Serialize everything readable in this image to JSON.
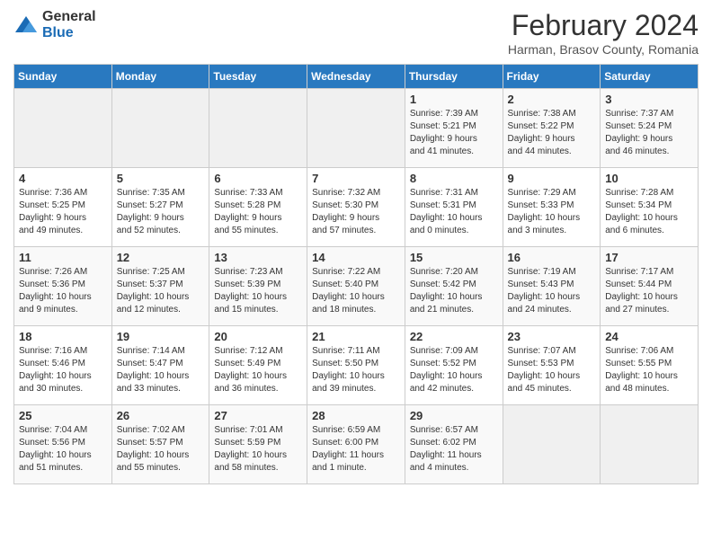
{
  "logo": {
    "general": "General",
    "blue": "Blue"
  },
  "header": {
    "title": "February 2024",
    "subtitle": "Harman, Brasov County, Romania"
  },
  "days_of_week": [
    "Sunday",
    "Monday",
    "Tuesday",
    "Wednesday",
    "Thursday",
    "Friday",
    "Saturday"
  ],
  "weeks": [
    [
      {
        "day": "",
        "info": ""
      },
      {
        "day": "",
        "info": ""
      },
      {
        "day": "",
        "info": ""
      },
      {
        "day": "",
        "info": ""
      },
      {
        "day": "1",
        "info": "Sunrise: 7:39 AM\nSunset: 5:21 PM\nDaylight: 9 hours\nand 41 minutes."
      },
      {
        "day": "2",
        "info": "Sunrise: 7:38 AM\nSunset: 5:22 PM\nDaylight: 9 hours\nand 44 minutes."
      },
      {
        "day": "3",
        "info": "Sunrise: 7:37 AM\nSunset: 5:24 PM\nDaylight: 9 hours\nand 46 minutes."
      }
    ],
    [
      {
        "day": "4",
        "info": "Sunrise: 7:36 AM\nSunset: 5:25 PM\nDaylight: 9 hours\nand 49 minutes."
      },
      {
        "day": "5",
        "info": "Sunrise: 7:35 AM\nSunset: 5:27 PM\nDaylight: 9 hours\nand 52 minutes."
      },
      {
        "day": "6",
        "info": "Sunrise: 7:33 AM\nSunset: 5:28 PM\nDaylight: 9 hours\nand 55 minutes."
      },
      {
        "day": "7",
        "info": "Sunrise: 7:32 AM\nSunset: 5:30 PM\nDaylight: 9 hours\nand 57 minutes."
      },
      {
        "day": "8",
        "info": "Sunrise: 7:31 AM\nSunset: 5:31 PM\nDaylight: 10 hours\nand 0 minutes."
      },
      {
        "day": "9",
        "info": "Sunrise: 7:29 AM\nSunset: 5:33 PM\nDaylight: 10 hours\nand 3 minutes."
      },
      {
        "day": "10",
        "info": "Sunrise: 7:28 AM\nSunset: 5:34 PM\nDaylight: 10 hours\nand 6 minutes."
      }
    ],
    [
      {
        "day": "11",
        "info": "Sunrise: 7:26 AM\nSunset: 5:36 PM\nDaylight: 10 hours\nand 9 minutes."
      },
      {
        "day": "12",
        "info": "Sunrise: 7:25 AM\nSunset: 5:37 PM\nDaylight: 10 hours\nand 12 minutes."
      },
      {
        "day": "13",
        "info": "Sunrise: 7:23 AM\nSunset: 5:39 PM\nDaylight: 10 hours\nand 15 minutes."
      },
      {
        "day": "14",
        "info": "Sunrise: 7:22 AM\nSunset: 5:40 PM\nDaylight: 10 hours\nand 18 minutes."
      },
      {
        "day": "15",
        "info": "Sunrise: 7:20 AM\nSunset: 5:42 PM\nDaylight: 10 hours\nand 21 minutes."
      },
      {
        "day": "16",
        "info": "Sunrise: 7:19 AM\nSunset: 5:43 PM\nDaylight: 10 hours\nand 24 minutes."
      },
      {
        "day": "17",
        "info": "Sunrise: 7:17 AM\nSunset: 5:44 PM\nDaylight: 10 hours\nand 27 minutes."
      }
    ],
    [
      {
        "day": "18",
        "info": "Sunrise: 7:16 AM\nSunset: 5:46 PM\nDaylight: 10 hours\nand 30 minutes."
      },
      {
        "day": "19",
        "info": "Sunrise: 7:14 AM\nSunset: 5:47 PM\nDaylight: 10 hours\nand 33 minutes."
      },
      {
        "day": "20",
        "info": "Sunrise: 7:12 AM\nSunset: 5:49 PM\nDaylight: 10 hours\nand 36 minutes."
      },
      {
        "day": "21",
        "info": "Sunrise: 7:11 AM\nSunset: 5:50 PM\nDaylight: 10 hours\nand 39 minutes."
      },
      {
        "day": "22",
        "info": "Sunrise: 7:09 AM\nSunset: 5:52 PM\nDaylight: 10 hours\nand 42 minutes."
      },
      {
        "day": "23",
        "info": "Sunrise: 7:07 AM\nSunset: 5:53 PM\nDaylight: 10 hours\nand 45 minutes."
      },
      {
        "day": "24",
        "info": "Sunrise: 7:06 AM\nSunset: 5:55 PM\nDaylight: 10 hours\nand 48 minutes."
      }
    ],
    [
      {
        "day": "25",
        "info": "Sunrise: 7:04 AM\nSunset: 5:56 PM\nDaylight: 10 hours\nand 51 minutes."
      },
      {
        "day": "26",
        "info": "Sunrise: 7:02 AM\nSunset: 5:57 PM\nDaylight: 10 hours\nand 55 minutes."
      },
      {
        "day": "27",
        "info": "Sunrise: 7:01 AM\nSunset: 5:59 PM\nDaylight: 10 hours\nand 58 minutes."
      },
      {
        "day": "28",
        "info": "Sunrise: 6:59 AM\nSunset: 6:00 PM\nDaylight: 11 hours\nand 1 minute."
      },
      {
        "day": "29",
        "info": "Sunrise: 6:57 AM\nSunset: 6:02 PM\nDaylight: 11 hours\nand 4 minutes."
      },
      {
        "day": "",
        "info": ""
      },
      {
        "day": "",
        "info": ""
      }
    ]
  ]
}
